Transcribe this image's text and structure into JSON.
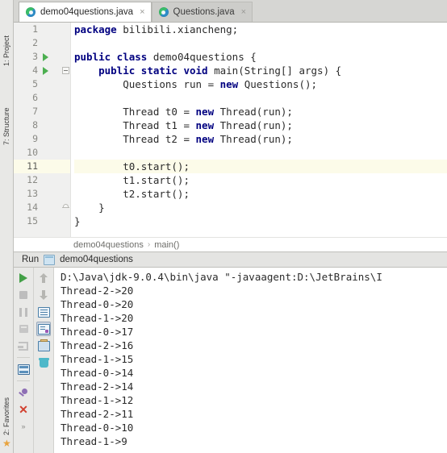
{
  "left_strip": {
    "project_label": "1: Project",
    "structure_label": "7: Structure",
    "favorites_label": "2: Favorites",
    "star_icon": "star-icon"
  },
  "tabs": [
    {
      "label": "demo04questions.java",
      "icon": "java-class-icon",
      "close": "×",
      "active": true
    },
    {
      "label": "Questions.java",
      "icon": "java-class-icon",
      "close": "×",
      "active": false
    }
  ],
  "editor": {
    "lines": [
      {
        "n": "1",
        "text": "package bilibili.xiancheng;",
        "kw": "package"
      },
      {
        "n": "2",
        "text": "",
        "kw": ""
      },
      {
        "n": "3",
        "text": "public class demo04questions {",
        "kw": "public class"
      },
      {
        "n": "4",
        "text": "    public static void main(String[] args) {",
        "kw": "public static void"
      },
      {
        "n": "5",
        "text": "        Questions run = new Questions();",
        "kw": "new"
      },
      {
        "n": "6",
        "text": "",
        "kw": ""
      },
      {
        "n": "7",
        "text": "        Thread t0 = new Thread(run);",
        "kw": "new"
      },
      {
        "n": "8",
        "text": "        Thread t1 = new Thread(run);",
        "kw": "new"
      },
      {
        "n": "9",
        "text": "        Thread t2 = new Thread(run);",
        "kw": "new"
      },
      {
        "n": "10",
        "text": "",
        "kw": ""
      },
      {
        "n": "11",
        "text": "        t0.start();",
        "kw": ""
      },
      {
        "n": "12",
        "text": "        t1.start();",
        "kw": ""
      },
      {
        "n": "13",
        "text": "        t2.start();",
        "kw": ""
      },
      {
        "n": "14",
        "text": "    }",
        "kw": ""
      },
      {
        "n": "15",
        "text": "}",
        "kw": ""
      }
    ],
    "current_line": "11",
    "run_arrow_lines": [
      "3",
      "4"
    ],
    "fold_open_line": "4",
    "fold_close_line": "14"
  },
  "breadcrumb": {
    "class": "demo04questions",
    "separator": "›",
    "method": "main()"
  },
  "run_window": {
    "title": "Run",
    "config_name": "demo04questions",
    "icon": "run-window-icon",
    "toolbar_left": [
      {
        "name": "rerun-button",
        "icon": "play-icon"
      },
      {
        "name": "stop-button",
        "icon": "stop-icon"
      },
      {
        "name": "pause-button",
        "icon": "pause-icon"
      },
      {
        "name": "thread-dump-button",
        "icon": "camera-icon"
      },
      {
        "name": "resume-button",
        "icon": "resume-icon"
      },
      {
        "name": "show-console-button",
        "icon": "console-icon"
      },
      {
        "name": "pin-tab-button",
        "icon": "pin-icon"
      },
      {
        "name": "close-button",
        "icon": "close-icon"
      },
      {
        "name": "more-button",
        "icon": "chevron-more-icon"
      }
    ],
    "toolbar_right": [
      {
        "name": "up-the-stack-button",
        "icon": "arrow-up-icon"
      },
      {
        "name": "down-the-stack-button",
        "icon": "arrow-down-icon"
      },
      {
        "name": "soft-wrap-button",
        "icon": "soft-wrap-icon"
      },
      {
        "name": "scroll-to-end-button",
        "icon": "scroll-to-end-icon",
        "selected": true
      },
      {
        "name": "print-button",
        "icon": "printer-icon"
      },
      {
        "name": "clear-all-button",
        "icon": "trash-icon"
      }
    ]
  },
  "console": {
    "lines": [
      "D:\\Java\\jdk-9.0.4\\bin\\java \"-javaagent:D:\\JetBrains\\I",
      "Thread-2->20",
      "Thread-0->20",
      "Thread-1->20",
      "Thread-0->17",
      "Thread-2->16",
      "Thread-1->15",
      "Thread-0->14",
      "Thread-2->14",
      "Thread-1->12",
      "Thread-2->11",
      "Thread-0->10",
      "Thread-1->9"
    ]
  },
  "colors": {
    "keyword": "#000080",
    "current_line": "#fcfbe9",
    "run_green": "#43a047",
    "close_red": "#d1402f"
  }
}
